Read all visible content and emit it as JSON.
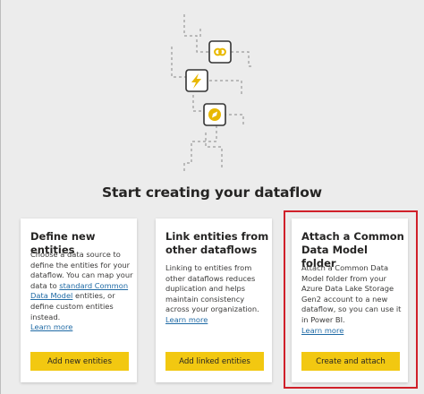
{
  "headline": "Start creating your dataflow",
  "colors": {
    "accent": "#f2c811",
    "link": "#1f6aa5",
    "highlight": "#d0202a",
    "background": "#ececec"
  },
  "illustration_icons": [
    "link-icon",
    "lightning-icon",
    "compass-icon"
  ],
  "cards": [
    {
      "title": "Define new entities",
      "desc_before": "Choose a data source to define the entities for your dataflow. You can map your data to ",
      "desc_link": "standard Common Data Model",
      "desc_after": " entities, or define custom entities instead.",
      "learn_more": "Learn more",
      "button": "Add new entities"
    },
    {
      "title": "Link entities from other dataflows",
      "desc": "Linking to entities from other dataflows reduces duplication and helps maintain consistency across your organization.",
      "learn_more": "Learn more",
      "button": "Add linked entities"
    },
    {
      "title": "Attach a Common Data Model folder",
      "desc": "Attach a Common Data Model folder from your Azure Data Lake Storage Gen2 account to a new dataflow, so you can use it in Power BI.",
      "learn_more": "Learn more",
      "button": "Create and attach"
    }
  ]
}
